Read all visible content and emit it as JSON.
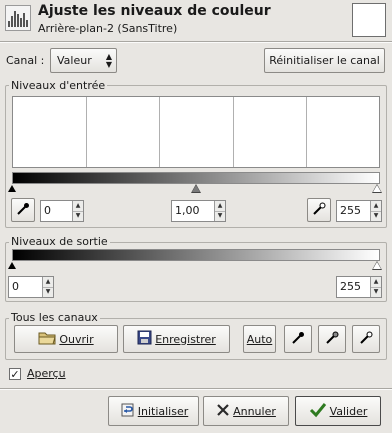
{
  "header": {
    "title": "Ajuste les niveaux de couleur",
    "subtitle": "Arrière-plan-2 (SansTitre)",
    "icon": "levels-icon"
  },
  "channel": {
    "label": "Canal :",
    "value": "Valeur",
    "reset_label": "Réinitialiser le canal"
  },
  "input_levels": {
    "title": "Niveaux d'entrée",
    "black": "0",
    "gamma": "1,00",
    "white": "255"
  },
  "output_levels": {
    "title": "Niveaux de sortie",
    "black": "0",
    "white": "255"
  },
  "all_channels": {
    "title": "Tous les canaux",
    "open_label": "Ouvrir",
    "save_label": "Enregistrer",
    "auto_label": "Auto"
  },
  "preview": {
    "label": "Aperçu",
    "checked": true,
    "mark": "✓"
  },
  "footer": {
    "reset_label": "Initialiser",
    "cancel_label": "Annuler",
    "ok_label": "Valider"
  }
}
